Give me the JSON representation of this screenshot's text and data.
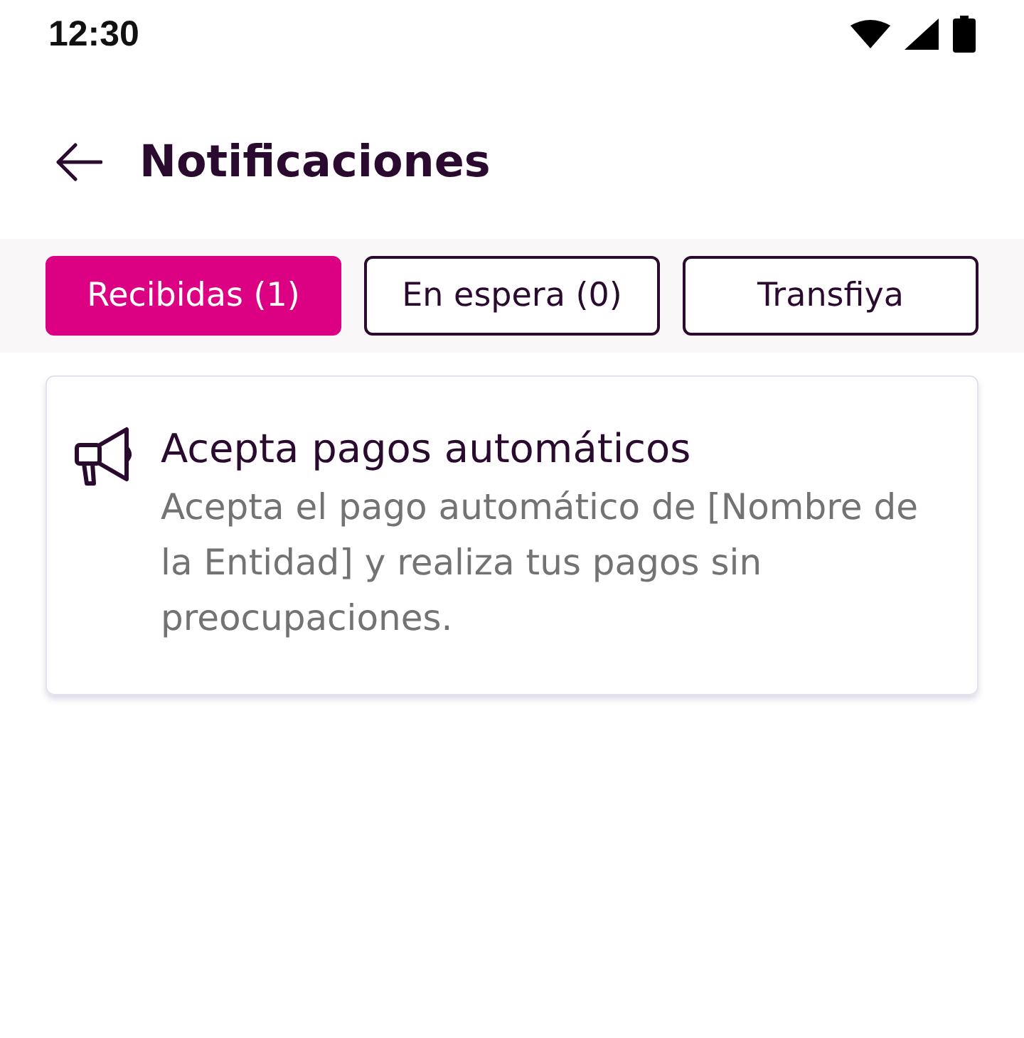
{
  "status_bar": {
    "time": "12:30"
  },
  "header": {
    "title": "Notificaciones"
  },
  "tabs": [
    {
      "label": "Recibidas (1)",
      "selected": true
    },
    {
      "label": "En espera (0)",
      "selected": false
    },
    {
      "label": "Transfiya",
      "selected": false
    }
  ],
  "notifications": [
    {
      "title": "Acepta pagos automáticos",
      "body": "Acepta el pago automático de [Nombre de la Entidad] y realiza tus pagos sin preocupaciones."
    }
  ]
}
